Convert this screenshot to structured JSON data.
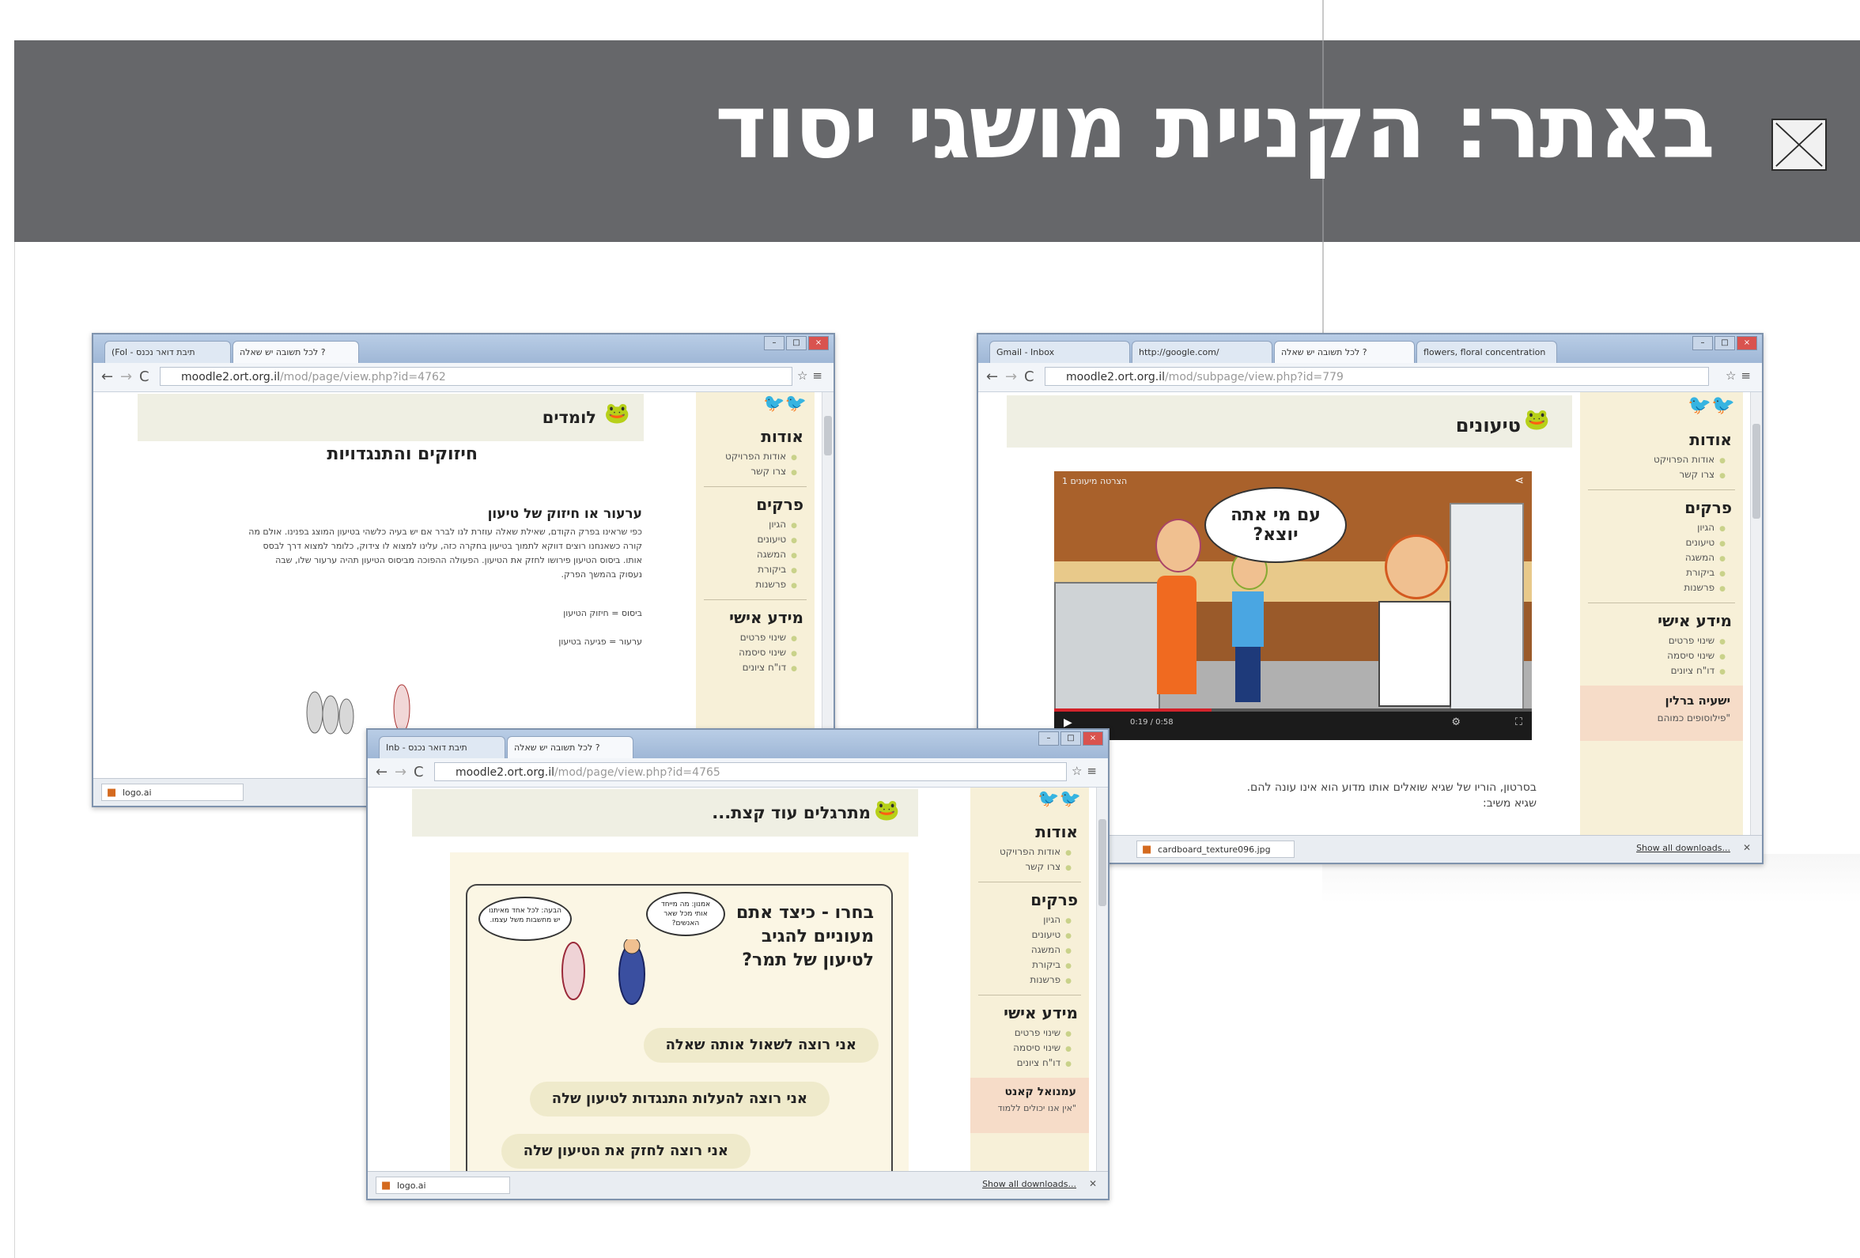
{
  "slide": {
    "title": "באתר: הקניית מושגי יסוד"
  },
  "left_window": {
    "tabs": [
      "(Fol - תיבת דואר נכנס",
      "לכל תשובה יש שאלה ?"
    ],
    "url_host": "moodle2.ort.org.il",
    "url_path": "/mod/page/view.php?id=4762",
    "page_title": "לומדים",
    "subtitle": "חיזוקים והתנגדויות",
    "section_heading": "ערעור או חיזוק של טיעון",
    "paragraph": [
      "כפי שראינו בפרק הקודם, שאילת שאלה עוזרת לנו לברר אם יש בעיה כלשהי בטיעון המוצג בפנינו. אולם מה",
      "קורה כשאנחנו רוצים דווקא לתמוך בטיעון בחקרה כזה, עלינו למצוא לו צידוק, כלומר למצוא דרך לבסס",
      "אותו. ביסוס הטיעון פירושו לחזק את הטיעון. הפעולה ההפוכה מביסוס הטיעון תהיה ערעור שלו, שבה",
      "נעסוק בהמשך הפרק."
    ],
    "def1": "ביסוס = חיזוק הטיעון",
    "def2": "ערעור = פגיעה בטיעון",
    "download": "logo.ai"
  },
  "right_window": {
    "tabs": [
      "Gmail - Inbox",
      "http://google.com/",
      "לכל תשובה יש שאלה ?",
      "flowers, floral concentration"
    ],
    "url_host": "moodle2.ort.org.il",
    "url_path": "/mod/subpage/view.php?id=779",
    "page_title": "טיעונים",
    "video_label": "הצרטה מיעונים 1",
    "speech_bubble": "עם מי אתה יוצא?",
    "video_time": "0:19 / 0:58",
    "caption_line1": "בסרטון, הוריו של שגיא שואלים אותו מדוע הוא אינו עונה להם.",
    "caption_line2": "שגיא משיב:",
    "download": "cardboard_texture096.jpg",
    "download_all": "Show all downloads...",
    "quote_name": "ישעיה ברלין",
    "quote_text": "\"פילוסופים כמוהם"
  },
  "bottom_window": {
    "tabs": [
      "Inb - תיבת דואר נכנס",
      "לכל תשובה יש שאלה ?"
    ],
    "url_host": "moodle2.ort.org.il",
    "url_path": "/mod/page/view.php?id=4765",
    "page_title": "מתרגלים עוד קצת...",
    "prompt": [
      "בחרו - כיצד אתם",
      "מעוניים להגיב",
      "לטיעון של תמר?"
    ],
    "bubble_left": "הבעה: לכל אחד מאיתנו יש מחשבות משל עצמו.",
    "bubble_right": "אמנון: מה מייחד אותי מכל שאר האנשים?",
    "options": [
      "אני רוצה לשאול אותה שאלה",
      "אני רוצה להעלות התנגדות לטיעון שלה",
      "אני רוצה לחזק את הטיעון שלה"
    ],
    "download": "logo.ai",
    "download_all": "Show all downloads...",
    "quote_name": "עמנואל קאנט",
    "quote_text": "\"אין אנו יכולים ללמוד"
  },
  "sidebar": {
    "about": "אודות",
    "about_items": [
      "אודות הפרויקט",
      "צרו קשר"
    ],
    "chapters": "פרקים",
    "chapter_items": [
      "הגיון",
      "טיעונים",
      "המשגה",
      "ביקורת",
      "פרשנות"
    ],
    "personal": "מידע אישי",
    "personal_items": [
      "שינוי פרטים",
      "שינוי סיסמה",
      "דו\"ח ציונים"
    ]
  },
  "colors": {
    "banner": "#66676a",
    "sidebar_bg": "#f7f0d8",
    "header_bg": "#efefe3",
    "option_pill": "#efeacb",
    "tab_strip": "#a9c0dc"
  }
}
